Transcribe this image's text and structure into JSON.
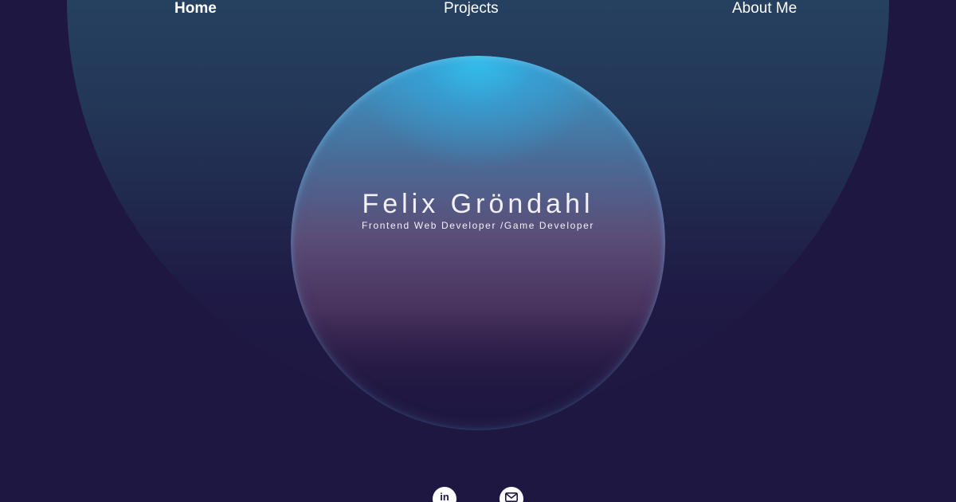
{
  "nav": {
    "home": "Home",
    "projects": "Projects",
    "about": "About Me"
  },
  "hero": {
    "name": "Felix Gröndahl",
    "role": "Frontend Web Developer /Game Developer"
  },
  "social": {
    "linkedin_icon": "linkedin-icon",
    "linkedin_glyph": "in",
    "email_icon": "email-icon"
  },
  "colors": {
    "background": "#1e1741",
    "accent_cyan": "#32c3f0",
    "text": "#ffffff"
  }
}
